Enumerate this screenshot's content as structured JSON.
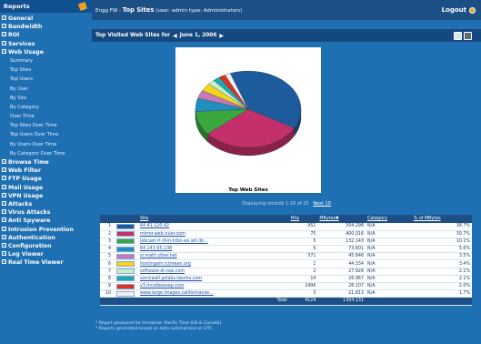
{
  "sidebar": {
    "header": "Reports",
    "groups_top": [
      "General",
      "Bandwidth",
      "ROI",
      "Services",
      "Web Usage"
    ],
    "web_usage_items": [
      "Summary",
      "Top Sites",
      "Top Users",
      "By User",
      "By Site",
      "By Category",
      "Over Time",
      "Top Sites Over Time",
      "Top Users Over Time",
      "By Users Over Time",
      "By Category Over Time"
    ],
    "groups_bottom": [
      "Browse Time",
      "Web Filter",
      "FTP Usage",
      "Mail Usage",
      "VPN Usage",
      "Attacks",
      "Virus Attacks",
      "Anti Spyware",
      "Intrusion Prevention",
      "Authentication",
      "Configuration",
      "Log Viewer",
      "Real Time Viewer"
    ]
  },
  "topbar": {
    "app": "Engg FW :",
    "page": "Top Sites",
    "user": "(user: admin   type: Administrators)",
    "logout": "Logout"
  },
  "content": {
    "title_prefix": "Top Visited Web Sites for",
    "date": "June 1, 2006",
    "chart_title": "Top Web Sites",
    "records_text": "Displaying records 1-10 of 25",
    "records_link": "Next 10",
    "footnote_1": "* Report produced for timezone: Pacific Time (US & Canada)",
    "footnote_2": "* Reports generated based on data summarized on UTC"
  },
  "table": {
    "headers": [
      "Site",
      "Hits",
      "MBytes",
      "Category",
      "% of MBytes"
    ],
    "rows": [
      {
        "n": "1",
        "site": "64.41.120.42",
        "hits": "951",
        "mb": "504.298",
        "cat": "N/A",
        "pct": "38.7%"
      },
      {
        "n": "2",
        "site": "mirror.web.ruler.com",
        "hits": "75",
        "mb": "400.016",
        "cat": "N/A",
        "pct": "30.7%"
      },
      {
        "n": "3",
        "site": "lobcast-rt-thin-tcbo-ws.wh.lib...",
        "hits": "5",
        "mb": "132.143",
        "cat": "N/A",
        "pct": "10.1%"
      },
      {
        "n": "4",
        "site": "64.143.95.138",
        "hits": "6",
        "mb": "73.601",
        "cat": "N/A",
        "pct": "5.6%"
      },
      {
        "n": "5",
        "site": "sr.math.ctker.net",
        "hits": "371",
        "mb": "45.846",
        "cat": "N/A",
        "pct": "3.5%"
      },
      {
        "n": "6",
        "site": "hostingam.ictmean.org",
        "hits": "1",
        "mb": "44.334",
        "cat": "N/A",
        "pct": "3.4%"
      },
      {
        "n": "7",
        "site": "software-dl.real.com",
        "hits": "2",
        "mb": "27.926",
        "cat": "N/A",
        "pct": "2.1%"
      },
      {
        "n": "8",
        "site": "sonicwall.gslabs.tworks.com",
        "hits": "14",
        "mb": "26.967",
        "cat": "N/A",
        "pct": "2.1%"
      },
      {
        "n": "9",
        "site": "v3.mcafeeasap.com",
        "hits": "2496",
        "mb": "26.107",
        "cat": "N/A",
        "pct": "2.0%"
      },
      {
        "n": "10",
        "site": "www.large.images.californiacoe...",
        "hits": "3",
        "mb": "21.813",
        "cat": "N/A",
        "pct": "1.7%"
      }
    ],
    "total_label": "Total",
    "total_hits": "4124",
    "total_mb": "1304.131"
  },
  "chart_data": {
    "type": "pie",
    "title": "Top Web Sites",
    "categories": [
      "64.41.120.42",
      "mirror.web.ruler.com",
      "lobcast-rt-thin-tcbo-ws.wh.lib...",
      "64.143.95.138",
      "sr.math.ctker.net",
      "hostingam.ictmean.org",
      "software-dl.real.com",
      "sonicwall.gslabs.tworks.com",
      "v3.mcafeeasap.com",
      "www.large.images.californiacoe..."
    ],
    "values": [
      38.7,
      30.7,
      10.1,
      5.6,
      3.5,
      3.4,
      2.1,
      2.1,
      2.0,
      1.7
    ],
    "colors": [
      "#1c5c9c",
      "#c4306b",
      "#3aa83c",
      "#1f8fbf",
      "#c47ab8",
      "#f3d51f",
      "#c8f0c8",
      "#1aa8b8",
      "#e03020",
      "#f0f0f0"
    ]
  }
}
